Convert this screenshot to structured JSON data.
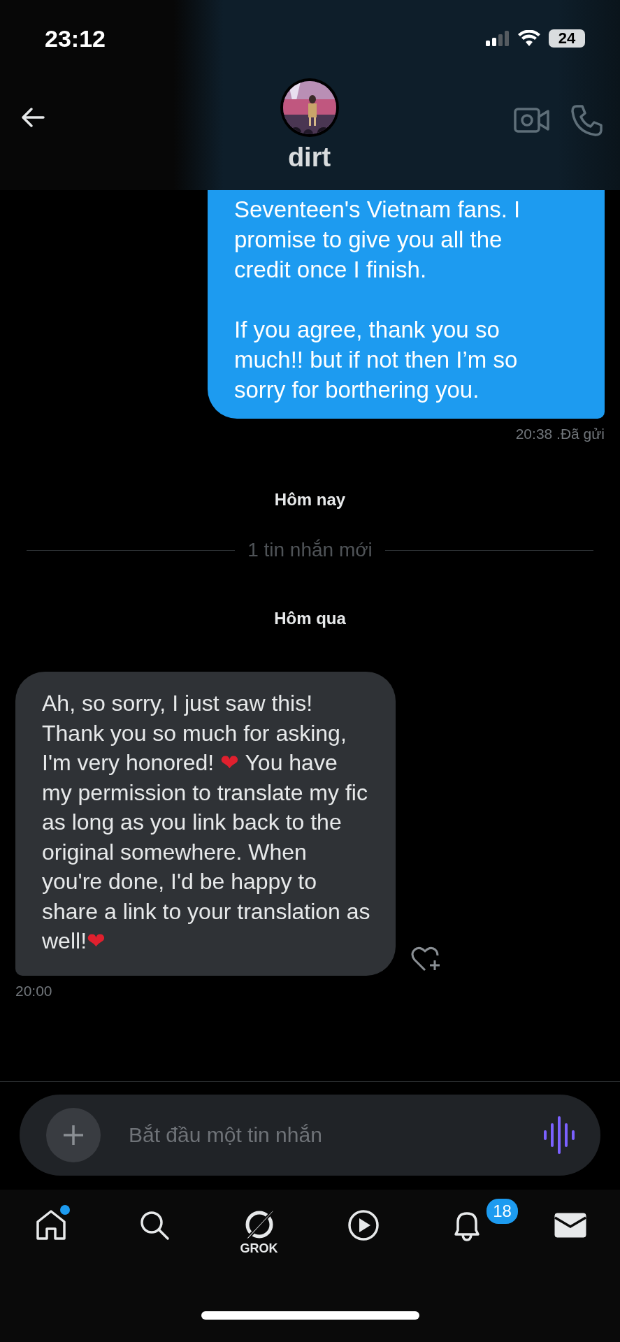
{
  "status_bar": {
    "time": "23:12",
    "battery": "24"
  },
  "header": {
    "name": "dirt"
  },
  "messages": [
    {
      "kind": "sent",
      "paragraphs": [
        "Seventeen's Vietnam fans. I promise to give you all the credit once I finish.",
        "If you agree, thank you so much!! but if not then I’m so sorry for borthering you."
      ],
      "meta": "20:38 .Đã gửi"
    },
    {
      "kind": "date",
      "text": "Hôm nay"
    },
    {
      "kind": "divider",
      "text": "1 tin nhắn mới"
    },
    {
      "kind": "date",
      "text": "Hôm qua"
    },
    {
      "kind": "received",
      "parts": [
        {
          "kind": "text",
          "text": "Ah, so sorry, I just saw this! Thank you so much for asking, I'm very honored! "
        },
        {
          "kind": "emoji",
          "text": "❤"
        },
        {
          "kind": "text",
          "text": " You have my permission to translate my fic as long as you link back to the original somewhere. When you're done, I'd be happy to share a link to your translation as well!"
        },
        {
          "kind": "emoji",
          "text": "❤"
        }
      ],
      "meta": "20:00"
    }
  ],
  "composer": {
    "placeholder": "Bắt đầu một tin nhắn"
  },
  "nav": [
    {
      "kind": "home",
      "selected": false,
      "dot": true
    },
    {
      "kind": "search",
      "selected": false
    },
    {
      "kind": "grok",
      "selected": false,
      "label": "GROK"
    },
    {
      "kind": "video",
      "selected": false
    },
    {
      "kind": "bell",
      "selected": false,
      "badge": "18"
    },
    {
      "kind": "mail",
      "selected": true
    }
  ]
}
